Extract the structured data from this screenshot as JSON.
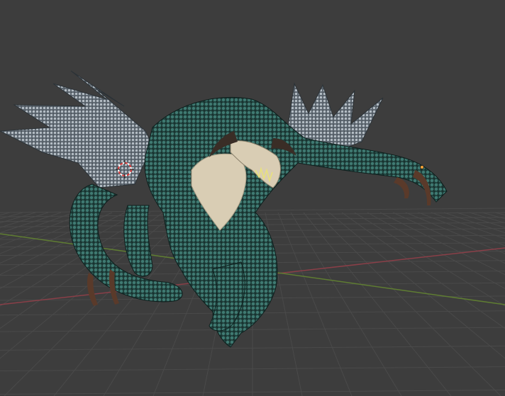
{
  "viewport": {
    "background": "#3d3d3d",
    "grid_color": "#4a4a4a",
    "x_axis_color": "#8a3f48",
    "y_axis_color": "#5f7d32"
  },
  "scene": {
    "object": "dragon-creature",
    "skin_color": "#1f3f3b",
    "skin_highlight": "#3f7a72",
    "wing_color": "#9aa3ab",
    "belly_color": "#d9cdb4",
    "horn_color": "#3a2d26",
    "claw_color": "#5a3a2a"
  },
  "cursor_3d": {
    "icon": "3d-cursor-icon",
    "ring_color": "#e03a3a",
    "ring_alt_color": "#ffffff"
  },
  "origin_marker": {
    "icon": "object-origin-icon",
    "color": "#f2a23a"
  }
}
